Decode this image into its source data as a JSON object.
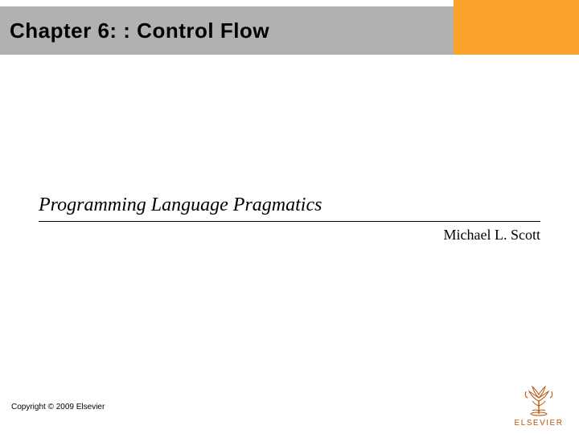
{
  "header": {
    "title": "Chapter 6: : Control Flow"
  },
  "subtitle": "Programming Language Pragmatics",
  "author": "Michael L. Scott",
  "copyright": "Copyright © 2009 Elsevier",
  "publisher_logo": {
    "name": "ELSEVIER"
  },
  "colors": {
    "title_bar": "#b1b1b1",
    "accent_block": "#f9a32a",
    "logo_text": "#b6540e"
  }
}
